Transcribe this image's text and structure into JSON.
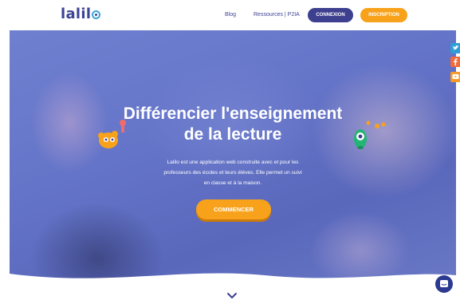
{
  "header": {
    "logo_text": "lalil",
    "nav": {
      "blog": "Blog",
      "resources": "Ressources | P2IA",
      "login": "CONNEXION",
      "signup": "INSCRIPTION"
    }
  },
  "hero": {
    "title_line1": "Différencier l'enseignement",
    "title_line2": "de la lecture",
    "description_line1": "Lalilo est une application web construite avec et pour les",
    "description_line2": "professeurs des écoles et leurs élèves. Elle permet un suivi",
    "description_line3": "en classe et à la maison.",
    "cta": "COMMENCER"
  },
  "social": {
    "twitter_icon": "twitter-icon",
    "facebook_icon": "facebook-icon",
    "youtube_icon": "youtube-icon"
  },
  "colors": {
    "brand_navy": "#3d3f8f",
    "accent_orange": "#f7a21a",
    "hero_blue": "#6474c8"
  }
}
